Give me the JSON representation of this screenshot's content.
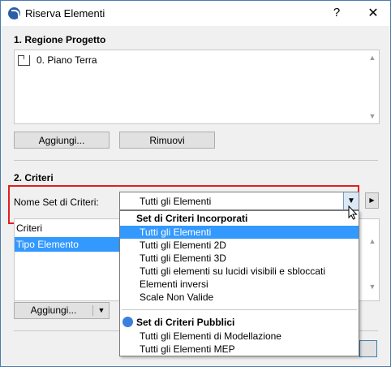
{
  "window": {
    "title": "Riserva Elementi",
    "help_label": "?",
    "close_label": "✕"
  },
  "section1": {
    "label": "1. Regione Progetto",
    "list_items": [
      "0. Piano Terra"
    ],
    "add_button": "Aggiungi...",
    "remove_button": "Rimuovi"
  },
  "section2": {
    "label": "2. Criteri",
    "field_label": "Nome Set di Criteri:",
    "combo_value": "Tutti gli Elementi",
    "list_header": "Criteri",
    "list_rows": [
      "Tipo Elemento"
    ],
    "add_button": "Aggiungi..."
  },
  "dropdown": {
    "group1_header": "Set di Criteri Incorporati",
    "group1_items": [
      "Tutti gli Elementi",
      "Tutti gli Elementi 2D",
      "Tutti gli Elementi 3D",
      "Tutti gli elementi su lucidi visibili e sbloccati",
      "Elementi inversi",
      "Scale Non Valide"
    ],
    "selected_index": 0,
    "group2_header": "Set di Criteri Pubblici",
    "group2_items": [
      "Tutti gli Elementi di Modellazione",
      "Tutti gli Elementi MEP"
    ]
  },
  "colors": {
    "accent": "#3399ff",
    "highlight_border": "#e02020"
  },
  "icons": {
    "app": "archicad-icon",
    "story": "story-icon",
    "dropdown": "chevron-down-icon",
    "side": "triangle-right-icon",
    "public": "blue-dot-icon",
    "cursor": "mouse-pointer-icon"
  }
}
